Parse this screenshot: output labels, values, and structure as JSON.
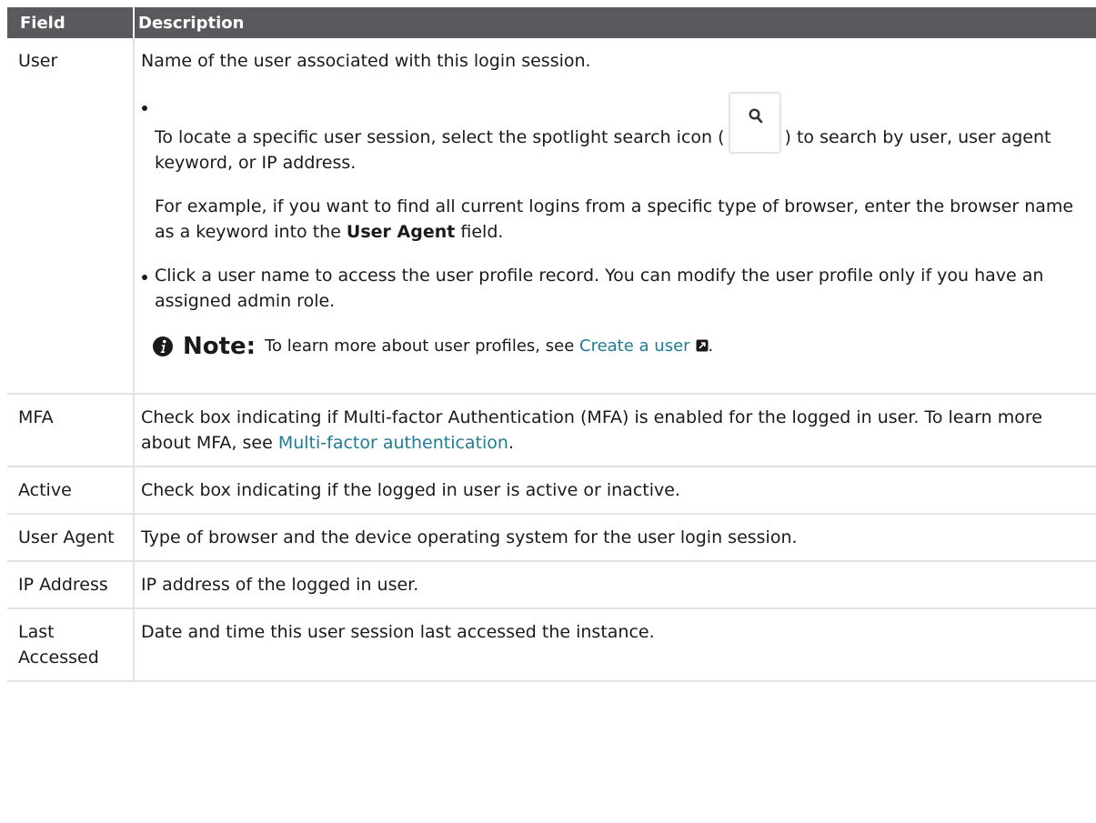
{
  "table": {
    "headers": {
      "field": "Field",
      "description": "Description"
    },
    "rows": {
      "user": {
        "field": "User",
        "description": "Name of the user associated with this login session.",
        "bullet1_before": "To locate a specific user session, select the spotlight search icon (",
        "bullet1_after": ") to search by user, user agent keyword, or IP address.",
        "bullet1_sub_before": "For example, if you want to find all current logins from a specific type of browser, enter the browser name as a keyword into the ",
        "bullet1_sub_bold": "User Agent",
        "bullet1_sub_after": " field.",
        "bullet2": "Click a user name to access the user profile record. You can modify the user profile only if you have an assigned admin role.",
        "note_label": "Note:",
        "note_text": "To learn more about user profiles, see ",
        "note_link": "Create a user",
        "note_end": "."
      },
      "mfa": {
        "field": "MFA",
        "description": "Check box indicating if Multi-factor Authentication (MFA) is enabled for the logged in user. To learn more about MFA, see ",
        "link": "Multi-factor authentication",
        "end": "."
      },
      "active": {
        "field": "Active",
        "description": "Check box indicating if the logged in user is active or inactive."
      },
      "user_agent": {
        "field": "User Agent",
        "description": "Type of browser and the device operating system for the user login session."
      },
      "ip_address": {
        "field": "IP Address",
        "description": "IP address of the logged in user."
      },
      "last_accessed": {
        "field": "Last Accessed",
        "description": "Date and time this user session last accessed the instance."
      }
    }
  },
  "icons": {
    "search": "search-icon",
    "info": "info-icon",
    "external_link": "external-link-icon"
  },
  "colors": {
    "header_bg": "#59595e",
    "link": "#1f7b94",
    "border": "#e3e3e3"
  }
}
